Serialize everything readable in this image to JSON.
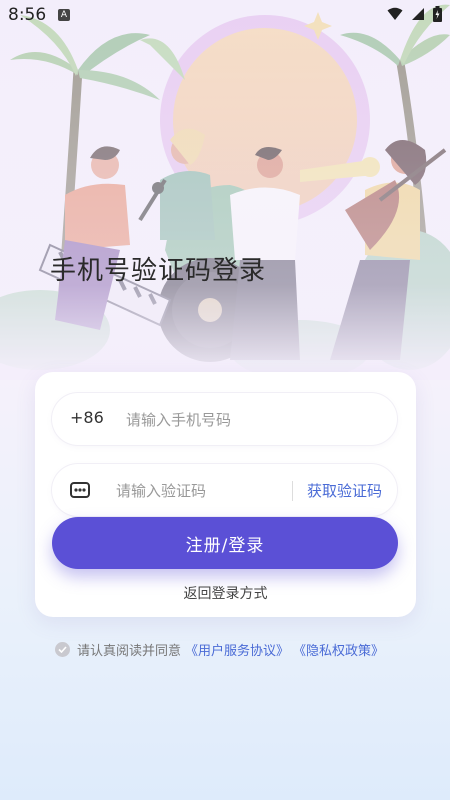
{
  "status_bar": {
    "time": "8:56",
    "notification_glyph": "A"
  },
  "page_title": "手机号验证码登录",
  "form": {
    "phone_prefix": "+86",
    "phone_placeholder": "请输入手机号码",
    "code_placeholder": "请输入验证码",
    "get_code_label": "获取验证码",
    "submit_label": "注册/登录",
    "back_label": "返回登录方式"
  },
  "agreement": {
    "text": "请认真阅读并同意",
    "user_agreement": "《用户服务协议》",
    "privacy_policy": "《隐私权政策》"
  },
  "colors": {
    "accent": "#5b50d6",
    "link": "#4a6bd6"
  },
  "icons": [
    "wifi-icon",
    "signal-icon",
    "battery-icon",
    "keypad-icon",
    "check-circle-icon"
  ]
}
